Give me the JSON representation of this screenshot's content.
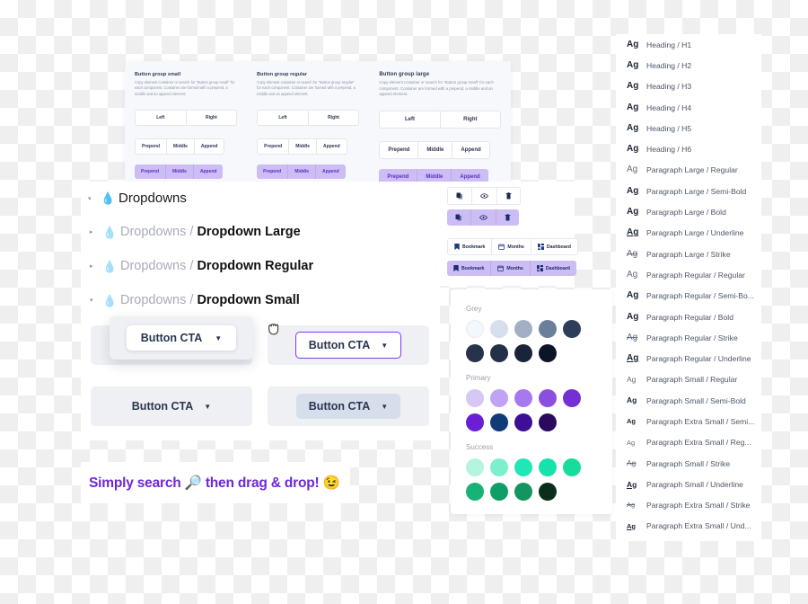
{
  "button_groups": [
    {
      "title": "Button group small",
      "description": "Copy element container or search for \"Button group small\" for each component. Container are formed with a prepend, a middle and an append element.",
      "left_label": "Left",
      "right_label": "Right",
      "segments": [
        "Prepend",
        "Middle",
        "Append"
      ]
    },
    {
      "title": "Button group regular",
      "description": "Copy element container or search for \"Button group regular\" for each component. Container are formed with a prepend, a middle and an append element.",
      "left_label": "Left",
      "right_label": "Right",
      "segments": [
        "Prepend",
        "Middle",
        "Append"
      ]
    },
    {
      "title": "Button group large",
      "description": "Copy element container or search for \"Button group small\" for each component. Container are formed with a prepend, a middle and an append element.",
      "left_label": "Left",
      "right_label": "Right",
      "segments": [
        "Prepend",
        "Middle",
        "Append"
      ]
    }
  ],
  "icon_strip": {
    "icons": [
      "copy-icon",
      "eye-icon",
      "trash-icon"
    ],
    "labeled": [
      {
        "icon": "bookmark-icon",
        "label": "Bookmark"
      },
      {
        "icon": "calendar-icon",
        "label": "Months"
      },
      {
        "icon": "dashboard-icon",
        "label": "Dashboard"
      }
    ]
  },
  "dropdowns_tree": [
    {
      "caret": "down",
      "prefix": "",
      "name": "Dropdowns",
      "level": 0
    },
    {
      "caret": "right",
      "prefix": "Dropdowns / ",
      "name": "Dropdown Large",
      "level": 1
    },
    {
      "caret": "right",
      "prefix": "Dropdowns / ",
      "name": "Dropdown Regular",
      "level": 1
    },
    {
      "caret": "down",
      "prefix": "Dropdowns / ",
      "name": "Dropdown Small",
      "level": 1
    }
  ],
  "dropdown_examples": {
    "label": "Button CTA",
    "chevron": "chevron-down-icon"
  },
  "drag": {
    "label": "Button CTA",
    "cursor": "grabbing-hand-cursor"
  },
  "palette": [
    {
      "name": "Grey",
      "colors": [
        "#f4f7fb",
        "#d6dfeb",
        "#a3b0c4",
        "#6b7f9c",
        "#2e3e58",
        "#26344b",
        "#233047",
        "#1a2439",
        "#0b1525"
      ]
    },
    {
      "name": "Primary",
      "colors": [
        "#d6c7f5",
        "#c0a4f3",
        "#a679ef",
        "#8b4fe0",
        "#7331d4",
        "#6a1fd4",
        "#103a78",
        "#3d0f96",
        "#2b0a5e"
      ]
    },
    {
      "name": "Success",
      "colors": [
        "#b5f5e0",
        "#7defcd",
        "#1fe8b5",
        "#16e2ab",
        "#16dd9c",
        "#18b276",
        "#0f9e66",
        "#12955f",
        "#0b2d1c"
      ]
    }
  ],
  "banner": {
    "text": "Simply search 🔎 then drag & drop! 😉"
  },
  "type_styles": [
    {
      "sample": "Ag",
      "label": "Heading / H1",
      "weight": "bold",
      "size": "lg",
      "deco": "none"
    },
    {
      "sample": "Ag",
      "label": "Heading / H2",
      "weight": "bold",
      "size": "lg",
      "deco": "none"
    },
    {
      "sample": "Ag",
      "label": "Heading / H3",
      "weight": "bold",
      "size": "lg",
      "deco": "none"
    },
    {
      "sample": "Ag",
      "label": "Heading / H4",
      "weight": "bold",
      "size": "lg",
      "deco": "none"
    },
    {
      "sample": "Ag",
      "label": "Heading / H5",
      "weight": "bold",
      "size": "lg",
      "deco": "none"
    },
    {
      "sample": "Ag",
      "label": "Heading / H6",
      "weight": "bold",
      "size": "lg",
      "deco": "none"
    },
    {
      "sample": "Ag",
      "label": "Paragraph Large / Regular",
      "weight": "reg",
      "size": "lg",
      "deco": "none"
    },
    {
      "sample": "Ag",
      "label": "Paragraph Large / Semi-Bold",
      "weight": "semi",
      "size": "lg",
      "deco": "none"
    },
    {
      "sample": "Ag",
      "label": "Paragraph Large / Bold",
      "weight": "bold",
      "size": "lg",
      "deco": "none"
    },
    {
      "sample": "Ag",
      "label": "Paragraph Large / Underline",
      "weight": "bold",
      "size": "lg",
      "deco": "u"
    },
    {
      "sample": "Ag",
      "label": "Paragraph Large / Strike",
      "weight": "reg",
      "size": "lg",
      "deco": "s"
    },
    {
      "sample": "Ag",
      "label": "Paragraph Regular / Regular",
      "weight": "reg",
      "size": "md",
      "deco": "none"
    },
    {
      "sample": "Ag",
      "label": "Paragraph Regular / Semi-Bo...",
      "weight": "semi",
      "size": "md",
      "deco": "none"
    },
    {
      "sample": "Ag",
      "label": "Paragraph Regular / Bold",
      "weight": "bold",
      "size": "md",
      "deco": "none"
    },
    {
      "sample": "Ag",
      "label": "Paragraph Regular / Strike",
      "weight": "reg",
      "size": "md",
      "deco": "s"
    },
    {
      "sample": "Ag",
      "label": "Paragraph Regular / Underline",
      "weight": "bold",
      "size": "md",
      "deco": "u"
    },
    {
      "sample": "Ag",
      "label": "Paragraph Small / Regular",
      "weight": "reg",
      "size": "sm",
      "deco": "none"
    },
    {
      "sample": "Ag",
      "label": "Paragraph Small / Semi-Bold",
      "weight": "semi",
      "size": "sm",
      "deco": "none"
    },
    {
      "sample": "Ag",
      "label": "Paragraph Extra Small / Semi...",
      "weight": "semi",
      "size": "xs",
      "deco": "none"
    },
    {
      "sample": "Ag",
      "label": "Paragraph Extra Small / Reg...",
      "weight": "reg",
      "size": "xs",
      "deco": "none"
    },
    {
      "sample": "Ag",
      "label": "Paragraph Small / Strike",
      "weight": "reg",
      "size": "sm",
      "deco": "s"
    },
    {
      "sample": "Ag",
      "label": "Paragraph Small / Underline",
      "weight": "bold",
      "size": "sm",
      "deco": "u"
    },
    {
      "sample": "Ag",
      "label": "Paragraph Extra Small / Strike",
      "weight": "reg",
      "size": "xs",
      "deco": "s"
    },
    {
      "sample": "Ag",
      "label": "Paragraph Extra Small / Und...",
      "weight": "semi",
      "size": "xs",
      "deco": "u"
    }
  ]
}
